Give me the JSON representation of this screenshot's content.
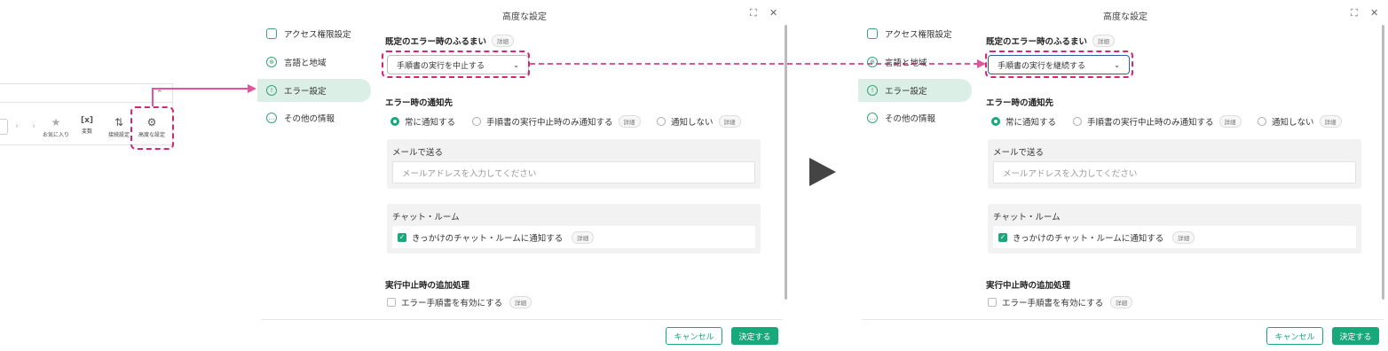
{
  "toolbar": {
    "items": [
      {
        "label": "お気に入り",
        "icon": "star-icon"
      },
      {
        "label": "変数",
        "icon": "variable-icon"
      },
      {
        "label": "接続設定",
        "icon": "connection-icon"
      },
      {
        "label": "高度な設定",
        "icon": "advanced-settings-icon"
      }
    ],
    "variable_glyph": "[x]"
  },
  "dialogs": [
    {
      "title": "高度な設定",
      "nav": [
        "アクセス権限設定",
        "言語と地域",
        "エラー設定",
        "その他の情報"
      ],
      "error_behavior_heading": "既定のエラー時のふるまい",
      "detail_badge": "詳細",
      "select_value": "手順書の実行を中止する",
      "notify_heading": "エラー時の通知先",
      "radio_always": "常に通知する",
      "radio_on_stop": "手順書の実行中止時のみ通知する",
      "radio_never": "通知しない",
      "email_title": "メールで送る",
      "email_placeholder": "メールアドレスを入力してください",
      "chat_title": "チャット・ルーム",
      "chat_checkbox": "きっかけのチャット・ルームに通知する",
      "extra_heading": "実行中止時の追加処理",
      "extra_checkbox": "エラー手順書を有効にする",
      "cancel": "キャンセル",
      "ok": "決定する"
    },
    {
      "title": "高度な設定",
      "nav": [
        "アクセス権限設定",
        "言語と地域",
        "エラー設定",
        "その他の情報"
      ],
      "error_behavior_heading": "既定のエラー時のふるまい",
      "detail_badge": "詳細",
      "select_value": "手順書の実行を継続する",
      "notify_heading": "エラー時の通知先",
      "radio_always": "常に通知する",
      "radio_on_stop": "手順書の実行中止時のみ通知する",
      "radio_never": "通知しない",
      "email_title": "メールで送る",
      "email_placeholder": "メールアドレスを入力してください",
      "chat_title": "チャット・ルーム",
      "chat_checkbox": "きっかけのチャット・ルームに通知する",
      "extra_heading": "実行中止時の追加処理",
      "extra_checkbox": "エラー手順書を有効にする",
      "cancel": "キャンセル",
      "ok": "決定する"
    }
  ],
  "colors": {
    "accent": "#19a879",
    "highlight": "#d6247a",
    "active_nav": "#dcefe6"
  }
}
